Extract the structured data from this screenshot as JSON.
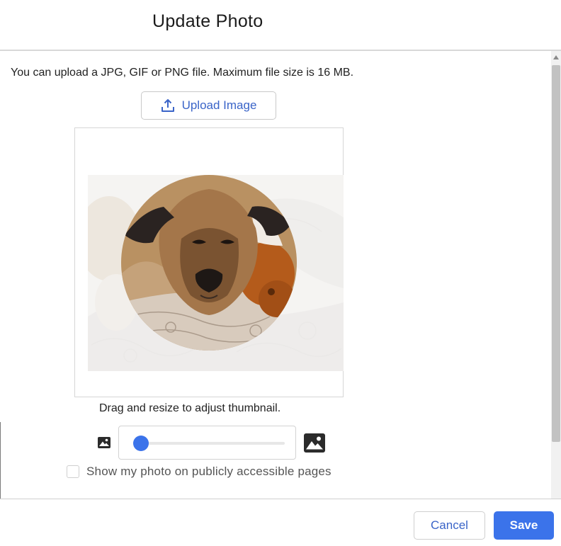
{
  "dialog": {
    "title": "Update Photo",
    "help_text": "You can upload a JPG, GIF or PNG file. Maximum file size is 16 MB.",
    "upload_button_label": "Upload Image",
    "crop_caption": "Drag and resize to adjust thumbnail.",
    "zoom": {
      "value_fraction": 0.05,
      "small_icon": "image-small-icon",
      "large_icon": "image-large-icon"
    },
    "public_checkbox": {
      "label": "Show my photo on publicly accessible pages",
      "checked": false
    }
  },
  "footer": {
    "cancel_label": "Cancel",
    "save_label": "Save"
  },
  "colors": {
    "accent": "#3b73ea",
    "link_text": "#3a64c8"
  }
}
